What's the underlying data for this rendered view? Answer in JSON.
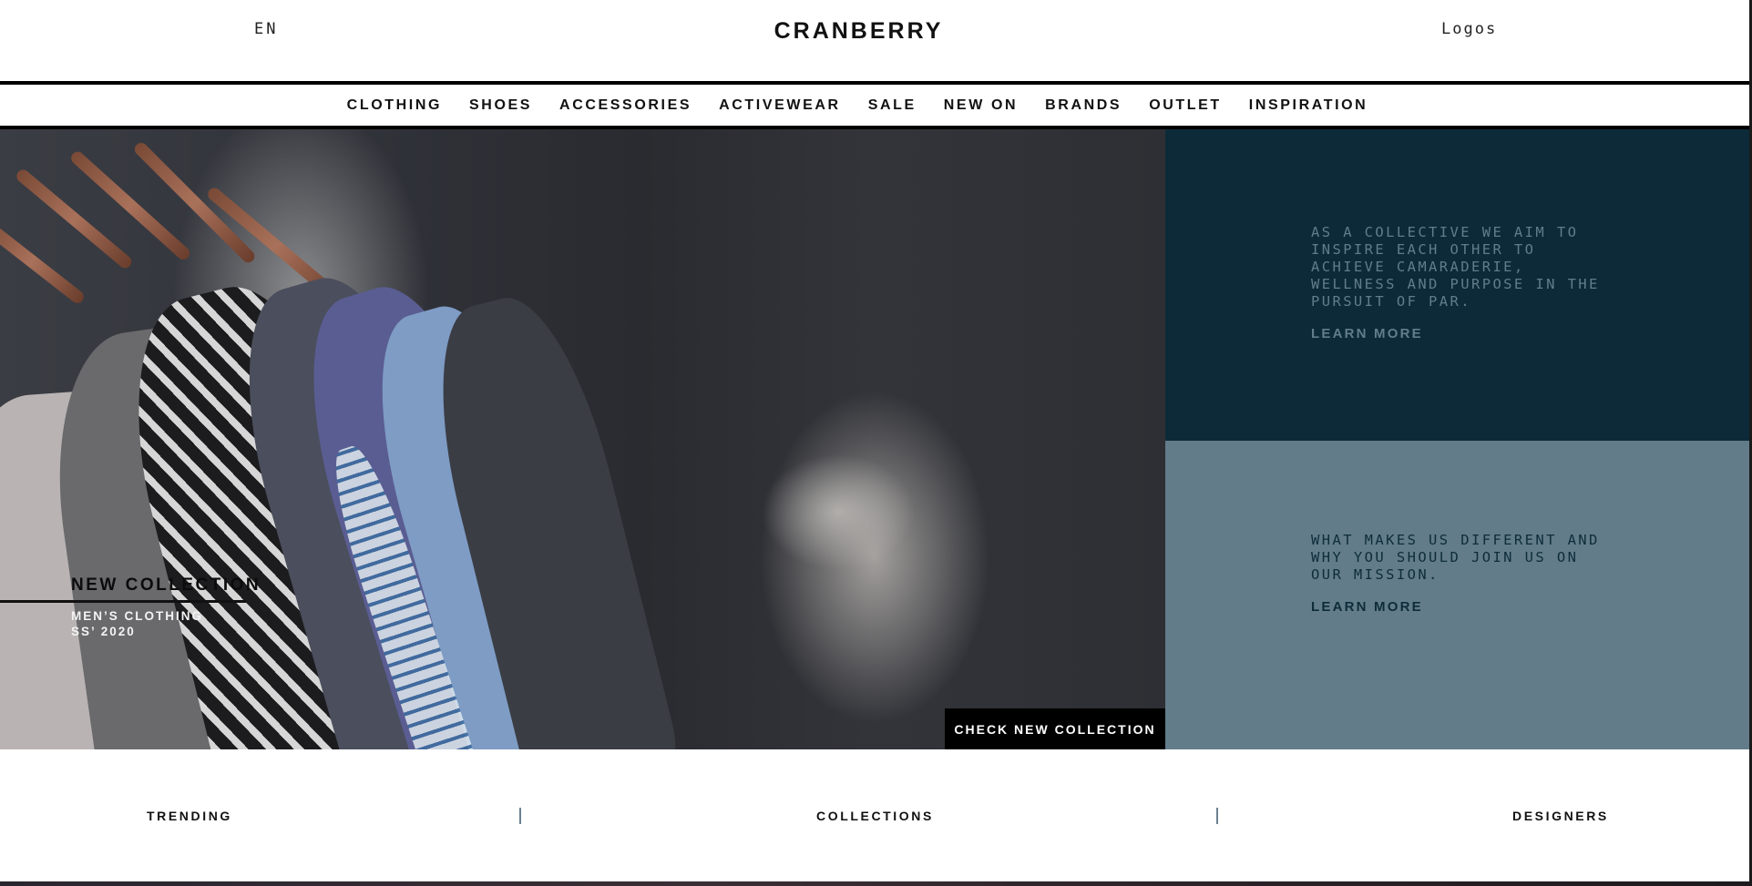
{
  "header": {
    "language": "EN",
    "brand": "CRANBERRY",
    "logos_link": "Logos"
  },
  "nav": {
    "items": [
      "CLOTHING",
      "SHOES",
      "ACCESSORIES",
      "ACTIVEWEAR",
      "SALE",
      "NEW ON",
      "BRANDS",
      "OUTLET",
      "INSPIRATION"
    ]
  },
  "hero": {
    "title": "NEW COLLECTION",
    "subtitle_line1": "MEN’S CLOTHING",
    "subtitle_line2": "SS’ 2020",
    "cta": "CHECK NEW COLLECTION"
  },
  "panels": {
    "top": {
      "text": "AS A COLLECTIVE WE AIM TO INSPIRE EACH OTHER TO ACHIEVE CAMARADERIE, WELLNESS AND PURPOSE IN THE PURSUIT OF PAR.",
      "link": "LEARN MORE",
      "bg_color": "#0c2a38"
    },
    "bottom": {
      "text": "WHAT MAKES US DIFFERENT AND WHY YOU SHOULD JOIN US ON OUR MISSION.",
      "link": "LEARN MORE",
      "bg_color": "#627c8a"
    }
  },
  "bottom_tabs": {
    "trending": "TRENDING",
    "collections": "COLLECTIONS",
    "designers": "DESIGNERS"
  }
}
